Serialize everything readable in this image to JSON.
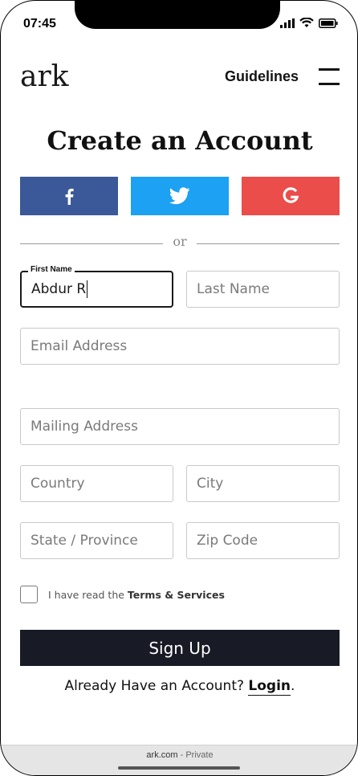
{
  "status_bar": {
    "time": "07:45"
  },
  "header": {
    "logo": "ark",
    "guidelines_label": "Guidelines"
  },
  "page": {
    "title": "Create an Account"
  },
  "social": {
    "facebook": "f",
    "twitter": "twitter",
    "google": "G"
  },
  "divider": {
    "label": "or"
  },
  "form": {
    "first_name": {
      "label": "First Name",
      "value": "Abdur R"
    },
    "last_name": {
      "placeholder": "Last Name"
    },
    "email": {
      "placeholder": "Email Address"
    },
    "mailing_address": {
      "placeholder": "Mailing Address"
    },
    "country": {
      "placeholder": "Country"
    },
    "city": {
      "placeholder": "City"
    },
    "state": {
      "placeholder": "State / Province"
    },
    "zip": {
      "placeholder": "Zip Code"
    },
    "terms": {
      "prefix": "I have read the ",
      "link": "Terms & Services",
      "checked": false
    },
    "signup_label": "Sign Up"
  },
  "footer": {
    "already_text": "Already Have an Account? ",
    "login_label": "Login",
    "period": "."
  },
  "browser": {
    "domain": "ark.com",
    "mode": " - Private"
  },
  "colors": {
    "facebook": "#3b5998",
    "twitter": "#1da1f2",
    "google": "#ea4d4a",
    "signup_bg": "#181a25"
  }
}
